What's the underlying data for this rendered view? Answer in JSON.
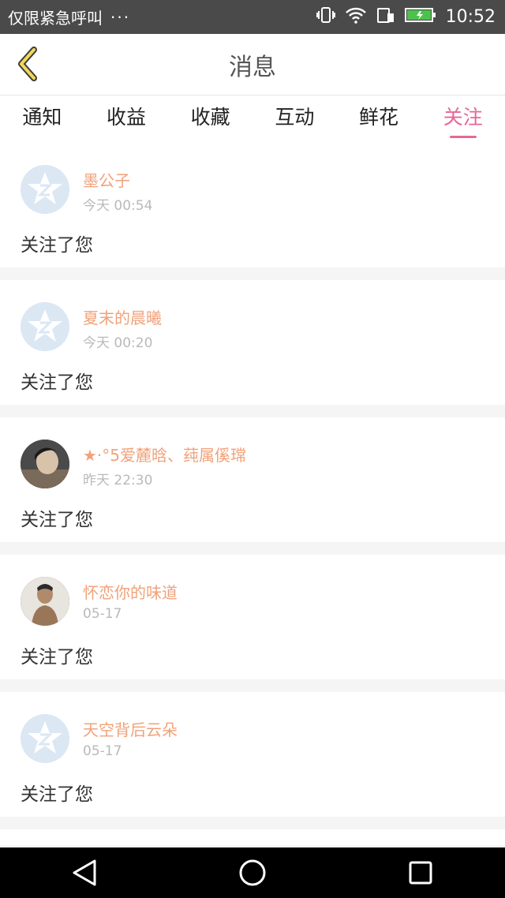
{
  "status_bar": {
    "carrier": "仅限紧急呼叫",
    "dots": "···",
    "time": "10:52"
  },
  "header": {
    "title": "消息",
    "back_icon": "chevron-left-icon"
  },
  "tabs": [
    {
      "label": "通知",
      "active": false
    },
    {
      "label": "收益",
      "active": false
    },
    {
      "label": "收藏",
      "active": false
    },
    {
      "label": "互动",
      "active": false
    },
    {
      "label": "鲜花",
      "active": false
    },
    {
      "label": "关注",
      "active": true
    }
  ],
  "messages": [
    {
      "name": "墨公子",
      "time": "今天 00:54",
      "content": "关注了您",
      "avatar": "default"
    },
    {
      "name": "夏末的晨曦",
      "time": "今天 00:20",
      "content": "关注了您",
      "avatar": "default"
    },
    {
      "name": "★·°5爱麓晗、莼属傒瑺",
      "time": "昨天 22:30",
      "content": "关注了您",
      "avatar": "photo"
    },
    {
      "name": "怀恋你的味道",
      "time": "05-17",
      "content": "关注了您",
      "avatar": "photo"
    },
    {
      "name": "天空背后云朵",
      "time": "05-17",
      "content": "关注了您",
      "avatar": "default"
    }
  ],
  "colors": {
    "accent": "#e56898",
    "name": "#f0a27a",
    "timestamp": "#b9b9b9"
  }
}
